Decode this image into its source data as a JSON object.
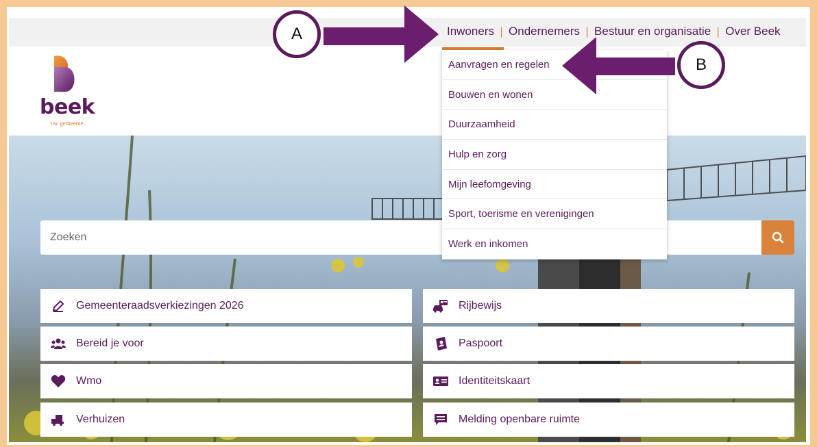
{
  "top_nav": {
    "items": [
      "Inwoners",
      "Ondernemers",
      "Bestuur en organisatie",
      "Over Beek"
    ],
    "separator": "|"
  },
  "logo": {
    "name": "beek",
    "tagline": "uw gemeente."
  },
  "search": {
    "placeholder": "Zoeken"
  },
  "dropdown": {
    "items": [
      "Aanvragen en regelen",
      "Bouwen en wonen",
      "Duurzaamheid",
      "Hulp en zorg",
      "Mijn leefomgeving",
      "Sport, toerisme en verenigingen",
      "Werk en inkomen"
    ]
  },
  "tiles": {
    "left": [
      {
        "label": "Gemeenteraadsverkiezingen 2026",
        "icon": "pencil-icon"
      },
      {
        "label": "Bereid je voor",
        "icon": "people-icon"
      },
      {
        "label": "Wmo",
        "icon": "heart-icon"
      },
      {
        "label": "Verhuizen",
        "icon": "moving-truck-icon"
      }
    ],
    "right": [
      {
        "label": "Rijbewijs",
        "icon": "car-id-icon"
      },
      {
        "label": "Paspoort",
        "icon": "passport-icon"
      },
      {
        "label": "Identiteitskaart",
        "icon": "id-card-icon"
      },
      {
        "label": "Melding openbare ruimte",
        "icon": "chat-icon"
      }
    ]
  },
  "annotations": {
    "a": "A",
    "b": "B"
  },
  "colors": {
    "brand_purple": "#5a1a5c",
    "accent_orange": "#d9823a",
    "frame_border": "#f6c994"
  }
}
